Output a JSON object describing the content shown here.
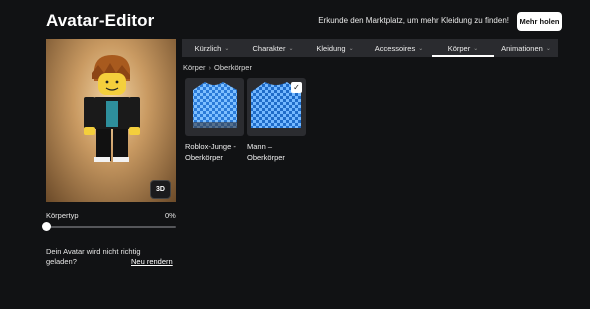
{
  "header": {
    "title": "Avatar-Editor",
    "promo_text": "Erkunde den Marktplatz, um mehr Kleidung zu finden!",
    "get_more_label": "Mehr holen"
  },
  "preview": {
    "view_toggle_label": "3D"
  },
  "body_type": {
    "label": "Körpertyp",
    "value": "0%",
    "level": 0
  },
  "render_notice": {
    "text": "Dein Avatar wird nicht richtig geladen?",
    "link_label": "Neu rendern"
  },
  "tabs": [
    {
      "label": "Kürzlich",
      "active": false
    },
    {
      "label": "Charakter",
      "active": false
    },
    {
      "label": "Kleidung",
      "active": false
    },
    {
      "label": "Accessoires",
      "active": false
    },
    {
      "label": "Körper",
      "active": true
    },
    {
      "label": "Animationen",
      "active": false
    }
  ],
  "breadcrumb": {
    "parent": "Körper",
    "separator": "›",
    "current": "Oberkörper"
  },
  "items": [
    {
      "label": "Roblox-Junge - Oberkörper",
      "selected": false
    },
    {
      "label": "Mann – Oberkörper",
      "selected": true
    }
  ],
  "colors": {
    "background": "#111214",
    "tab_bar": "#2a2b2f",
    "shirt_blue": "#2b7bd8"
  }
}
